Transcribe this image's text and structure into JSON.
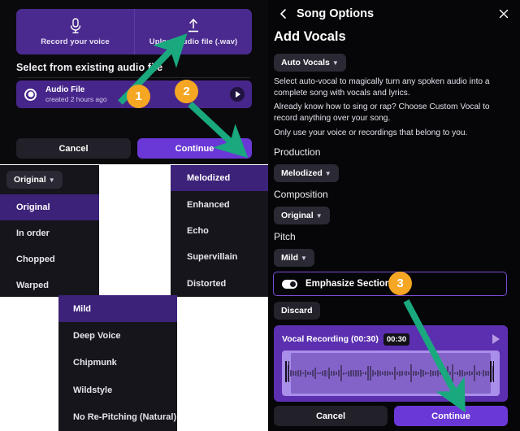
{
  "left_modal": {
    "sources": [
      {
        "label": "Record your voice",
        "icon": "microphone-icon"
      },
      {
        "label": "Upload audio file (.wav)",
        "icon": "upload-arrow-icon"
      }
    ],
    "section_label": "Select from existing audio file",
    "file": {
      "title": "Audio File",
      "subtitle": "created 2 hours ago",
      "selected": true,
      "play_icon": "play-icon"
    },
    "cancel_label": "Cancel",
    "continue_label": "Continue"
  },
  "dropdown_composition": {
    "trigger_label": "Original",
    "selected": "Original",
    "options": [
      "Original",
      "In order",
      "Chopped",
      "Warped"
    ]
  },
  "dropdown_production": {
    "selected": "Melodized",
    "options": [
      "Melodized",
      "Enhanced",
      "Echo",
      "Supervillain",
      "Distorted"
    ]
  },
  "dropdown_pitch": {
    "selected": "Mild",
    "options": [
      "Mild",
      "Deep Voice",
      "Chipmunk",
      "Wildstyle",
      "No Re-Pitching (Natural)"
    ]
  },
  "right_panel": {
    "header": {
      "back_icon": "chevron-left-icon",
      "title": "Song Options",
      "close_icon": "close-icon"
    },
    "heading": "Add Vocals",
    "vocal_mode_chip": "Auto Vocals",
    "paragraphs": [
      "Select auto-vocal to magically turn any spoken audio into a complete song with vocals and lyrics.",
      "Already know how to sing or rap? Choose Custom Vocal to record anything over your song.",
      "Only use your voice or recordings that belong to you."
    ],
    "groups": [
      {
        "label": "Production",
        "value": "Melodized"
      },
      {
        "label": "Composition",
        "value": "Original"
      },
      {
        "label": "Pitch",
        "value": "Mild"
      }
    ],
    "emphasize": {
      "label": "Emphasize Section",
      "toggle_state": "on"
    },
    "discard_label": "Discard",
    "recording": {
      "title": "Vocal Recording (00:30)",
      "duration_badge": "00:30",
      "play_icon": "play-icon"
    },
    "cancel_label": "Cancel",
    "continue_label": "Continue"
  },
  "callouts": [
    {
      "number": "1",
      "target": "Upload audio file (.wav)"
    },
    {
      "number": "2",
      "target": "Continue"
    },
    {
      "number": "3",
      "target": "Continue"
    }
  ],
  "colors": {
    "accent_purple": "#6a38d6",
    "deep_purple": "#4a2a8f",
    "badge_orange": "#f5a623",
    "arrow_green": "#1aa87e",
    "panel_dark": "#16151b",
    "selected_item": "#3c2279"
  }
}
